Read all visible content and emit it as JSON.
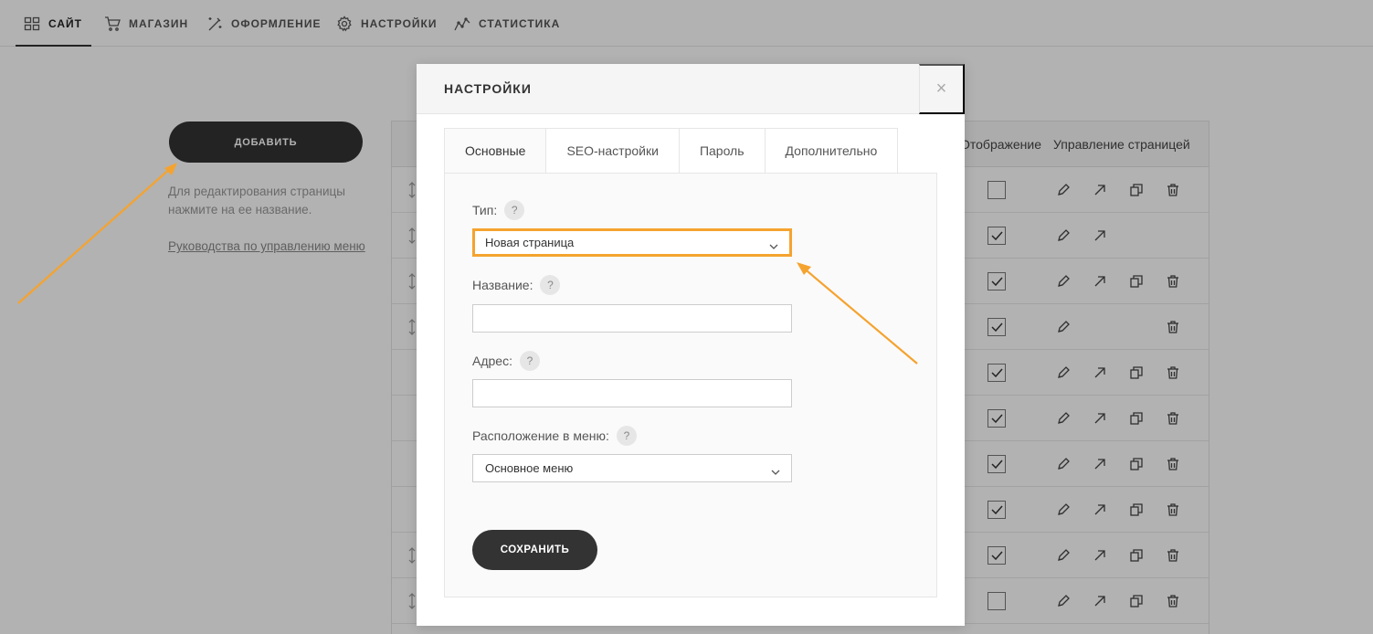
{
  "nav": {
    "items": [
      {
        "label": "САЙТ",
        "icon": "grid-icon"
      },
      {
        "label": "МАГАЗИН",
        "icon": "cart-icon"
      },
      {
        "label": "ОФОРМЛЕНИЕ",
        "icon": "magic-wand-icon"
      },
      {
        "label": "НАСТРОЙКИ",
        "icon": "gear-icon"
      },
      {
        "label": "СТАТИСТИКА",
        "icon": "stats-icon"
      }
    ],
    "active": "САЙТ"
  },
  "sidebar": {
    "add_label": "ДОБАВИТЬ",
    "hint": "Для редактирования страницы нажмите на ее название.",
    "guide_link": "Руководства по управлению меню"
  },
  "table": {
    "col_display": "Отображение",
    "col_manage": "Управление страницей",
    "rows": [
      {
        "drag": true,
        "checked": false,
        "actions": [
          "edit",
          "open",
          "copy",
          "delete"
        ]
      },
      {
        "drag": true,
        "checked": true,
        "actions": [
          "edit",
          "open"
        ]
      },
      {
        "drag": true,
        "checked": true,
        "actions": [
          "edit",
          "open",
          "copy",
          "delete"
        ]
      },
      {
        "drag": true,
        "checked": true,
        "actions": [
          "edit",
          "delete"
        ]
      },
      {
        "drag": false,
        "checked": true,
        "actions": [
          "edit",
          "open",
          "copy",
          "delete"
        ]
      },
      {
        "drag": false,
        "checked": true,
        "actions": [
          "edit",
          "open",
          "copy",
          "delete"
        ]
      },
      {
        "drag": false,
        "checked": true,
        "actions": [
          "edit",
          "open",
          "copy",
          "delete"
        ]
      },
      {
        "drag": false,
        "checked": true,
        "actions": [
          "edit",
          "open",
          "copy",
          "delete"
        ]
      },
      {
        "drag": true,
        "checked": true,
        "actions": [
          "edit",
          "open",
          "copy",
          "delete"
        ]
      },
      {
        "drag": true,
        "checked": false,
        "actions": [
          "edit",
          "open",
          "copy",
          "delete"
        ]
      }
    ]
  },
  "modal": {
    "title": "НАСТРОЙКИ",
    "close": "×",
    "tabs": [
      "Основные",
      "SEO-настройки",
      "Пароль",
      "Дополнительно"
    ],
    "active_tab": "Основные",
    "fields": {
      "type_label": "Тип:",
      "type_value": "Новая страница",
      "name_label": "Название:",
      "name_value": "",
      "address_label": "Адрес:",
      "address_value": "",
      "menu_label": "Расположение в меню:",
      "menu_value": "Основное меню",
      "help": "?"
    },
    "save_label": "СОХРАНИТЬ"
  },
  "colors": {
    "highlight": "#f5a32f",
    "dark_button": "#333333",
    "overlay": "rgba(0,0,0,0.3)"
  }
}
